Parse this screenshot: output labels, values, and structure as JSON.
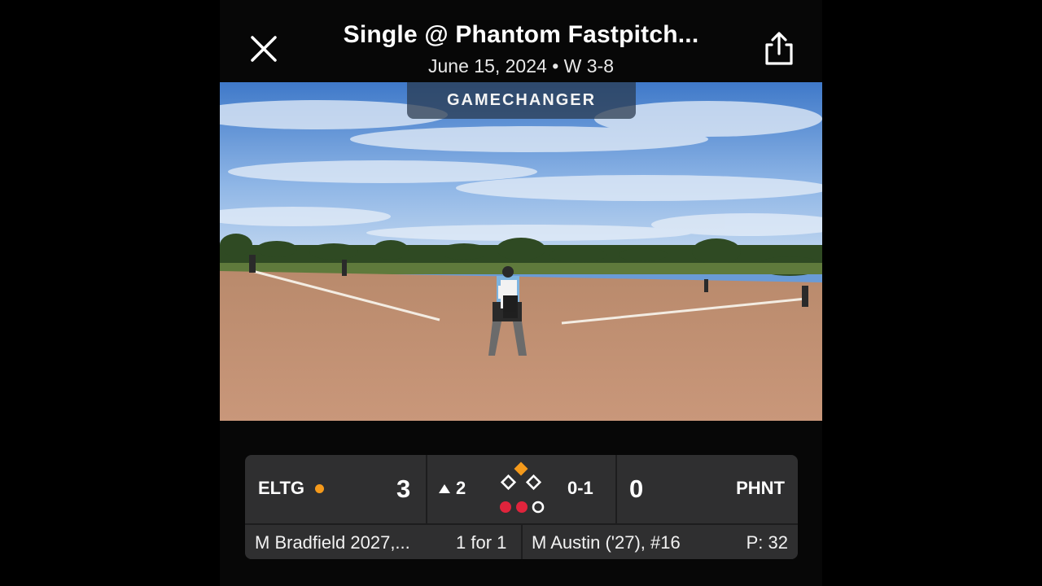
{
  "header": {
    "title": "Single @ Phantom Fastpitch...",
    "subtitle": "June 15, 2024 • W 3-8",
    "close_icon": "close-icon",
    "share_icon": "share-icon"
  },
  "video": {
    "watermark": "GAMECHANGER"
  },
  "scorebug": {
    "away_team": "ELTG",
    "away_score": "3",
    "home_team": "PHNT",
    "home_score": "0",
    "inning": "2",
    "inning_half": "top",
    "count": "0-1",
    "outs": 2,
    "bases": {
      "first": false,
      "second": true,
      "third": false
    },
    "possession_color": "#f59a1b",
    "base_occupied_color": "#f59a1b",
    "out_color": "#e0243c",
    "batter": "M Bradfield 2027,...",
    "batter_stat": "1 for 1",
    "pitcher": "M Austin ('27), #16",
    "pitch_count": "P: 32"
  }
}
